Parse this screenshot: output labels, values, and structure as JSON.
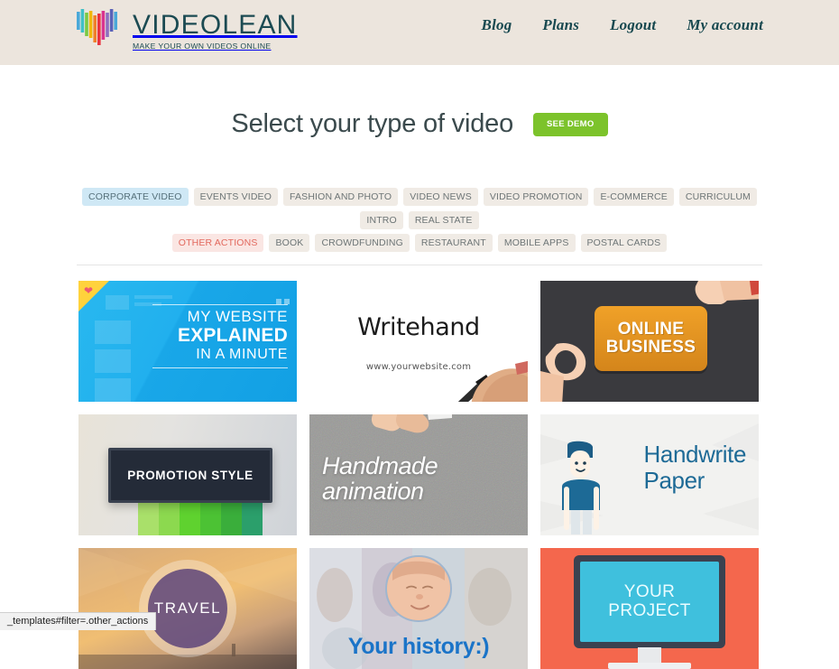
{
  "header": {
    "brand_name": "VIDEOLEAN",
    "brand_tagline": "MAKE YOUR OWN VIDEOS ONLINE",
    "logo_icon": "videolean-v-bars-logo",
    "nav": [
      {
        "label": "Blog"
      },
      {
        "label": "Plans"
      },
      {
        "label": "Logout"
      },
      {
        "label": "My account"
      }
    ],
    "background_color": "#ece5dd",
    "text_color": "#17484f"
  },
  "main": {
    "title": "Select your type of video",
    "demo_button": "SEE DEMO",
    "demo_button_color": "#7cc32b",
    "filters": {
      "row1": [
        {
          "label": "CORPORATE VIDEO",
          "state": "hover"
        },
        {
          "label": "EVENTS VIDEO",
          "state": "normal"
        },
        {
          "label": "FASHION AND PHOTO",
          "state": "normal"
        },
        {
          "label": "VIDEO NEWS",
          "state": "normal"
        },
        {
          "label": "VIDEO PROMOTION",
          "state": "normal"
        },
        {
          "label": "E-COMMERCE",
          "state": "normal"
        },
        {
          "label": "CURRICULUM",
          "state": "normal"
        },
        {
          "label": "INTRO",
          "state": "normal"
        },
        {
          "label": "REAL STATE",
          "state": "normal"
        }
      ],
      "row2": [
        {
          "label": "OTHER ACTIONS",
          "state": "active"
        },
        {
          "label": "BOOK",
          "state": "normal"
        },
        {
          "label": "CROWDFUNDING",
          "state": "normal"
        },
        {
          "label": "RESTAURANT",
          "state": "normal"
        },
        {
          "label": "MOBILE APPS",
          "state": "normal"
        },
        {
          "label": "POSTAL CARDS",
          "state": "normal"
        }
      ],
      "active_color": "#e2685d",
      "hover_color": "#cfe8f5",
      "tag_color": "#f0ebe5"
    },
    "templates": [
      {
        "name": "my-website-explained",
        "line1": "MY WEBSITE",
        "line2": "EXPLAINED",
        "line3": "IN A MINUTE",
        "badge_icon": "heart-icon",
        "background_color": "#21b0ee"
      },
      {
        "name": "writehand",
        "title": "Writehand",
        "url": "www.yourwebsite.com",
        "background_color": "#ffffff"
      },
      {
        "name": "online-business",
        "line1": "ONLINE",
        "line2": "BUSINESS",
        "background_color": "#3a3a3e",
        "plaque_color": "#e09321"
      },
      {
        "name": "promotion-style",
        "title": "PROMOTION STYLE",
        "background_color": "#e4e3e0",
        "bar_colors": [
          "#a9e06a",
          "#8cd94f",
          "#5fd22f",
          "#4cc234",
          "#3aae3b",
          "#2b9f6b"
        ]
      },
      {
        "name": "handmade-animation",
        "line1": "Handmade",
        "line2": "animation",
        "background_color": "#9a9a98"
      },
      {
        "name": "handwrite-paper",
        "line1": "Handwrite",
        "line2": "Paper",
        "background_color": "#f2f2f0",
        "text_color": "#1d6a96"
      },
      {
        "name": "travel",
        "title": "TRAVEL",
        "background_color": "#e7b574"
      },
      {
        "name": "your-history",
        "title": "Your history:)",
        "background_color": "#cfd2da",
        "text_color": "#1b74c8"
      },
      {
        "name": "your-project",
        "line1": "YOUR",
        "line2": "PROJECT",
        "background_color": "#f4674d",
        "screen_color": "#3fc0dd"
      }
    ]
  },
  "status_bar": {
    "url": "_templates#filter=.other_actions"
  }
}
